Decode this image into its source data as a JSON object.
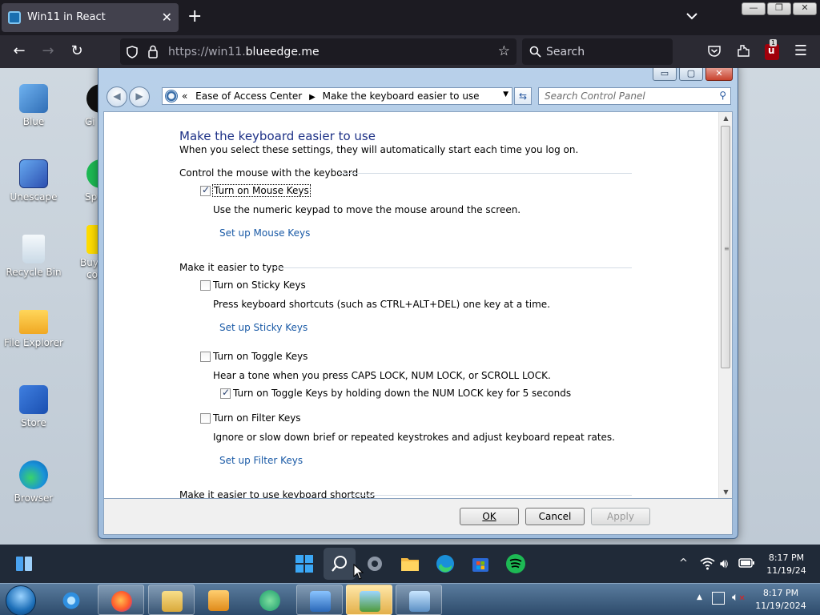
{
  "browser": {
    "tab_title": "Win11 in React",
    "tab_close": "✕",
    "new_tab": "+",
    "url_prefix": "https://win11.",
    "url_host": "blueedge.me",
    "search_placeholder": "Search",
    "badge_count": "1",
    "window_controls": [
      "—",
      "❐",
      "✕"
    ]
  },
  "desktop": {
    "icons": [
      {
        "label": "Blue",
        "color": "#4a90d9"
      },
      {
        "label": "Unescape",
        "color": "#3b6fc9"
      },
      {
        "label": "Recycle Bin",
        "color": "#e6eef5"
      },
      {
        "label": "File Explorer",
        "color": "#f2b632"
      },
      {
        "label": "Store",
        "color": "#2563c7"
      },
      {
        "label": "Browser",
        "color": "#1aa1d9"
      }
    ],
    "partial_labels": [
      "Gi",
      "Sp",
      "Buy",
      "co"
    ]
  },
  "dialog": {
    "caption_buttons": [
      "▭",
      "▢",
      "✕"
    ],
    "breadcrumb": {
      "prefix": "«",
      "parent": "Ease of Access Center",
      "separator": "▶",
      "current": "Make the keyboard easier to use",
      "dropdown": "▼"
    },
    "refresh": "⇆",
    "search_placeholder": "Search Control Panel",
    "title": "Make the keyboard easier to use",
    "subtitle": "When you select these settings, they will automatically start each time you log on.",
    "groups": {
      "mouse": {
        "heading": "Control the mouse with the keyboard",
        "option": "Turn on Mouse Keys",
        "checked": true,
        "description": "Use the numeric keypad to move the mouse around the screen.",
        "link": "Set up Mouse Keys"
      },
      "type": {
        "heading": "Make it easier to type",
        "sticky_option": "Turn on Sticky Keys",
        "sticky_checked": false,
        "sticky_description": "Press keyboard shortcuts (such as CTRL+ALT+DEL) one key at a time.",
        "sticky_link": "Set up Sticky Keys",
        "toggle_option": "Turn on Toggle Keys",
        "toggle_checked": false,
        "toggle_description": "Hear a tone when you press CAPS LOCK, NUM LOCK, or SCROLL LOCK.",
        "toggle_sub_option": "Turn on Toggle Keys by holding down the NUM LOCK key for 5 seconds",
        "toggle_sub_checked": true,
        "filter_option": "Turn on Filter Keys",
        "filter_checked": false,
        "filter_description": "Ignore or slow down brief or repeated keystrokes and adjust keyboard repeat rates.",
        "filter_link": "Set up Filter Keys"
      },
      "shortcuts": {
        "heading": "Make it easier to use keyboard shortcuts"
      }
    },
    "buttons": {
      "ok": "OK",
      "cancel": "Cancel",
      "apply": "Apply"
    }
  },
  "taskbar11": {
    "time": "8:17 PM",
    "date": "11/19/24",
    "overflow": "^"
  },
  "taskbar7": {
    "time": "8:17 PM",
    "date": "11/19/2024"
  },
  "colors": {
    "link": "#1a5aa6",
    "title": "#1e3287",
    "desktop_bg": "#c9d4de"
  }
}
